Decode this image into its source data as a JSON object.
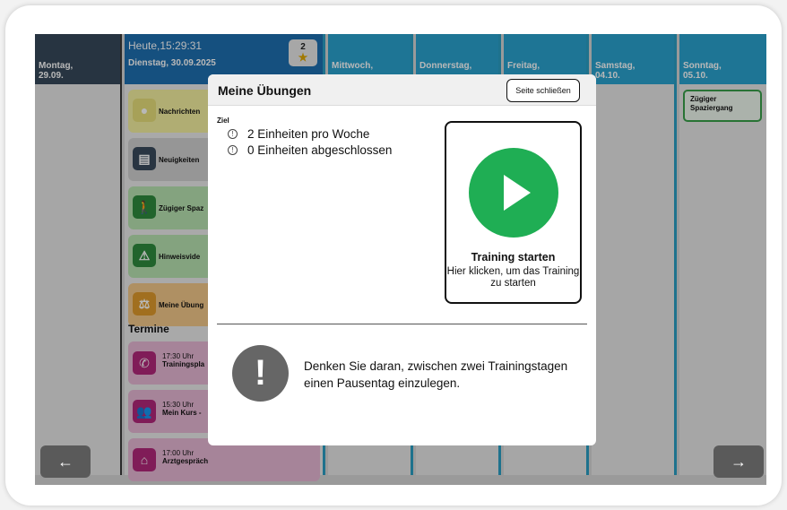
{
  "days": {
    "monday": "Montag,\n29.09.",
    "tuesday_time": "Heute,15:29:31",
    "tuesday_date": "Dienstag, 30.09.2025",
    "wednesday": "Mittwoch,",
    "thursday": "Donnerstag,",
    "friday": "Freitag,",
    "saturday": "Samstag,\n04.10.",
    "sunday": "Sonntag,\n05.10."
  },
  "badge": {
    "count": "2",
    "icon": "star-icon"
  },
  "tiles": [
    {
      "label": "Nachrichten",
      "icon": "chat-icon",
      "bg": "#f4f0a0",
      "icon_bg": "#e8e07a"
    },
    {
      "label": "Neuigkeiten",
      "icon": "newspaper-icon",
      "bg": "#d0d0d0",
      "icon_bg": "#3a4a5c"
    },
    {
      "label": "Zügiger Spaz",
      "icon": "walking-icon",
      "bg": "#b8e2b0",
      "icon_bg": "#2e8b3e"
    },
    {
      "label": "Hinweisvide",
      "icon": "warning-icon",
      "bg": "#b8e2b0",
      "icon_bg": "#2e8b3e"
    },
    {
      "label": "Meine Übung",
      "icon": "scale-icon",
      "bg": "#f3c88a",
      "icon_bg": "#e09a2c"
    }
  ],
  "termine_heading": "Termine",
  "appointments": [
    {
      "time": "17:30 Uhr",
      "title": "Trainingspla",
      "icon": "phone-icon"
    },
    {
      "time": "15:30 Uhr",
      "title": "Mein Kurs - ",
      "icon": "group-icon"
    },
    {
      "time": "17:00 Uhr",
      "title": "Arztgespräch",
      "icon": "home-icon"
    }
  ],
  "sunday_event": "Zügiger Spaziergang",
  "nav": {
    "prev": "←",
    "next": "→"
  },
  "modal": {
    "title": "Meine Übungen",
    "close_label": "Seite schließen",
    "ziel_label": "Ziel",
    "goals": [
      "2 Einheiten pro Woche",
      "0 Einheiten abgeschlossen"
    ],
    "training_title": "Training starten",
    "training_sub": "Hier klicken, um das Training zu starten",
    "hint": "Denken Sie daran, zwischen zwei Trainingstagen einen Pausentag einzulegen."
  },
  "colors": {
    "accent": "#2aa2cf",
    "today": "#1e6fb0",
    "play": "#1fae54",
    "appointment": "#e7b7d4"
  }
}
